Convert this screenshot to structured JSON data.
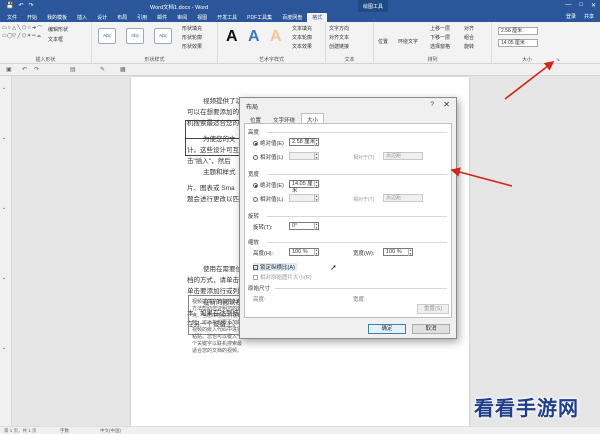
{
  "window": {
    "title": "Word文档1.docx - Word",
    "tool_tag": "绘图工具",
    "min": "—",
    "max": "□",
    "close": "✕"
  },
  "quick_access": {
    "save_icon": "💾",
    "undo_icon": "↶",
    "redo_icon": "↷"
  },
  "tabs": [
    "文件",
    "开始",
    "我的模板",
    "插入",
    "设计",
    "布局",
    "引用",
    "邮件",
    "审阅",
    "视图",
    "开发工具",
    "PDF工具集",
    "百度网盘",
    "格式"
  ],
  "active_tab": 13,
  "tabs_right": {
    "login": "登录",
    "share": "共享"
  },
  "ribbon": {
    "insert_shapes": {
      "label": "插入形状",
      "edit_shape": "编辑形状",
      "textbox": "文本框",
      "shapes": [
        "▭",
        "○",
        "△",
        "╲",
        "⬠",
        "☆",
        "➔",
        "⌒",
        "▭",
        "◯",
        "▽",
        "╱",
        "⬡",
        "✶",
        "⇨",
        "⌓"
      ]
    },
    "shape_styles": {
      "label": "形状样式",
      "boxes": [
        "Abc",
        "Abc",
        "Abc"
      ],
      "fill": "形状填充",
      "outline": "形状轮廓",
      "effect": "形状效果"
    },
    "art_styles": {
      "label": "艺术字样式",
      "letters": [
        "A",
        "A",
        "A"
      ],
      "text_fill": "文本填充",
      "text_outline": "文本轮廓",
      "text_effect": "文本效果"
    },
    "text": {
      "label": "文本",
      "direction": "文字方向",
      "align": "对齐文本",
      "link": "创建链接"
    },
    "arrange": {
      "label": "排列",
      "position": "位置",
      "wrap": "环绕文字",
      "forward": "上移一层",
      "backward": "下移一层",
      "pane": "选择窗格",
      "align": "对齐",
      "group": "组合",
      "rotate": "旋转"
    },
    "size": {
      "label": "大小",
      "height": "2.58 厘米",
      "width": "14.05 厘米"
    }
  },
  "document": {
    "paragraphs": [
      "视频提供了功",
      "可以在想要添加的",
      "机搜索最适合您的",
      "为使您的文",
      "计。这些设计可互",
      "击\"插入\"，然后",
      "主题和样式",
      "片、图表或 Sma",
      "题会进行更改以匹",
      "使用在需要位置出现的新按钮在 Word 中保存时间。若要更改图片适应文",
      "档的方式，请单击该图片，图片旁边将会显示布局选项按钮。当处理表格时，",
      "单击要添加行或列的位置，然后单击加号。",
      "在新的阅读视图中阅读更加容易。可以折叠文档某些部分并关注所需文",
      "本。如果在达到结尾处之前需要停止读取，Word 会记住您的停止位置 - 即使",
      "在另一个设备上。"
    ],
    "textbox": "视频提供了功能强大的方法帮助您证明您的观点。当您单击联机视频时，可以在想要添加的视频的嵌入代码中进行粘贴。您也可以键入一个关键字以联机搜索最适合您的文档的视频。"
  },
  "dialog": {
    "title": "布局",
    "help": "?",
    "close": "✕",
    "tabs": [
      "位置",
      "文字环绕",
      "大小"
    ],
    "active_tab": 2,
    "height_section": "高度",
    "width_section": "宽度",
    "rotate_section": "旋转",
    "scale_section": "缩放",
    "original_section": "原始尺寸",
    "absolute": "绝对值(E)",
    "relative": "相对值(L)",
    "relative_to": "相对于(T)",
    "height_value": "2.58 厘米",
    "width_value": "14.05 厘米",
    "relative_dropdown": "页边距",
    "rotation_label": "旋转(T):",
    "rotation_value": "0°",
    "scale_height_label": "高度(H):",
    "scale_height_value": "100 %",
    "scale_width_label": "宽度(W):",
    "scale_width_value": "100 %",
    "lock_ratio": "锁定纵横比(A)",
    "relative_original": "相对原始图片大小(R)",
    "original_height": "高度:",
    "original_width": "宽度:",
    "reset": "重置(S)",
    "ok": "确定",
    "cancel": "取消"
  },
  "status": {
    "page": "第 1 页，共 1 页",
    "words": "字数",
    "lang": "中文(中国)",
    "zoom": "100%"
  },
  "watermark": "看看手游网",
  "colors": {
    "accent": "#2b579a",
    "arrow": "#d2261c"
  }
}
